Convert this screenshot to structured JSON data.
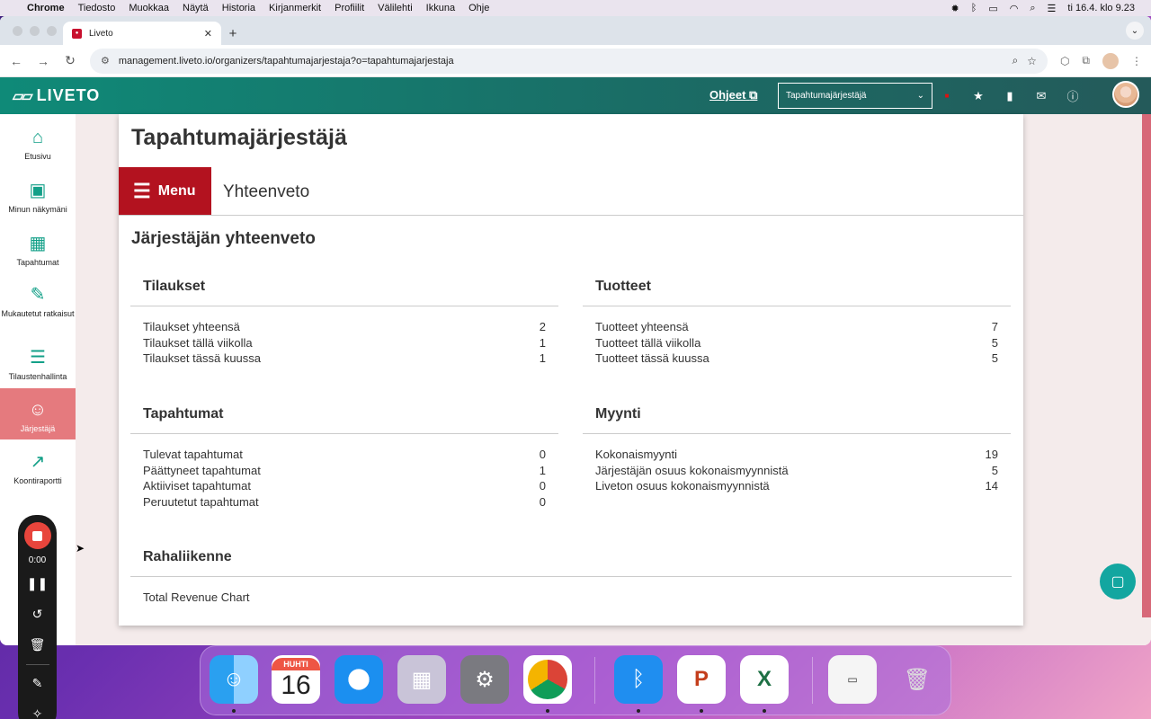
{
  "menubar": {
    "items": [
      "Chrome",
      "Tiedosto",
      "Muokkaa",
      "Näytä",
      "Historia",
      "Kirjanmerkit",
      "Profiilit",
      "Välilehti",
      "Ikkuna",
      "Ohje"
    ],
    "clock": "ti 16.4. klo 9.23"
  },
  "browser": {
    "tab_title": "Liveto",
    "url": "management.liveto.io/organizers/tapahtumajarjestaja?o=tapahtumajarjestaja"
  },
  "header": {
    "logo": "LIVETO",
    "help_link": "Ohjeet",
    "org_select": "Tapahtumajärjestäjä"
  },
  "sidebar": {
    "items": [
      {
        "label": "Etusivu",
        "icon": "home-icon"
      },
      {
        "label": "Minun näkymäni",
        "icon": "layout-icon"
      },
      {
        "label": "Tapahtumat",
        "icon": "calendar-icon"
      },
      {
        "label": "Mukautetut ratkaisut",
        "icon": "edit-icon"
      },
      {
        "label": "Tilaustenhallinta",
        "icon": "list-icon"
      },
      {
        "label": "Järjestäjä",
        "icon": "users-icon"
      },
      {
        "label": "Koontiraportti",
        "icon": "chart-icon"
      }
    ]
  },
  "page": {
    "title": "Tapahtumajärjestäjä",
    "menu_button": "Menu",
    "section": "Yhteenveto",
    "subtitle": "Järjestäjän yhteenveto"
  },
  "cards": {
    "orders": {
      "title": "Tilaukset",
      "rows": [
        {
          "label": "Tilaukset yhteensä",
          "value": "2"
        },
        {
          "label": "Tilaukset tällä viikolla",
          "value": "1"
        },
        {
          "label": "Tilaukset tässä kuussa",
          "value": "1"
        }
      ]
    },
    "products": {
      "title": "Tuotteet",
      "rows": [
        {
          "label": "Tuotteet yhteensä",
          "value": "7"
        },
        {
          "label": "Tuotteet tällä viikolla",
          "value": "5"
        },
        {
          "label": "Tuotteet tässä kuussa",
          "value": "5"
        }
      ]
    },
    "events": {
      "title": "Tapahtumat",
      "rows": [
        {
          "label": "Tulevat tapahtumat",
          "value": "0"
        },
        {
          "label": "Päättyneet tapahtumat",
          "value": "1"
        },
        {
          "label": "Aktiiviset tapahtumat",
          "value": "0"
        },
        {
          "label": "Peruutetut tapahtumat",
          "value": "0"
        }
      ]
    },
    "sales": {
      "title": "Myynti",
      "rows": [
        {
          "label": "Kokonaismyynti",
          "value": "19"
        },
        {
          "label": "Järjestäjän osuus kokonaismyynnistä",
          "value": "5"
        },
        {
          "label": "Liveton osuus kokonaismyynnistä",
          "value": "14"
        }
      ]
    },
    "cashflow": {
      "title": "Rahaliikenne",
      "content": "Total Revenue Chart"
    }
  },
  "recorder": {
    "time": "0:00"
  },
  "dock": {
    "calendar_month": "HUHTI",
    "calendar_day": "16"
  }
}
